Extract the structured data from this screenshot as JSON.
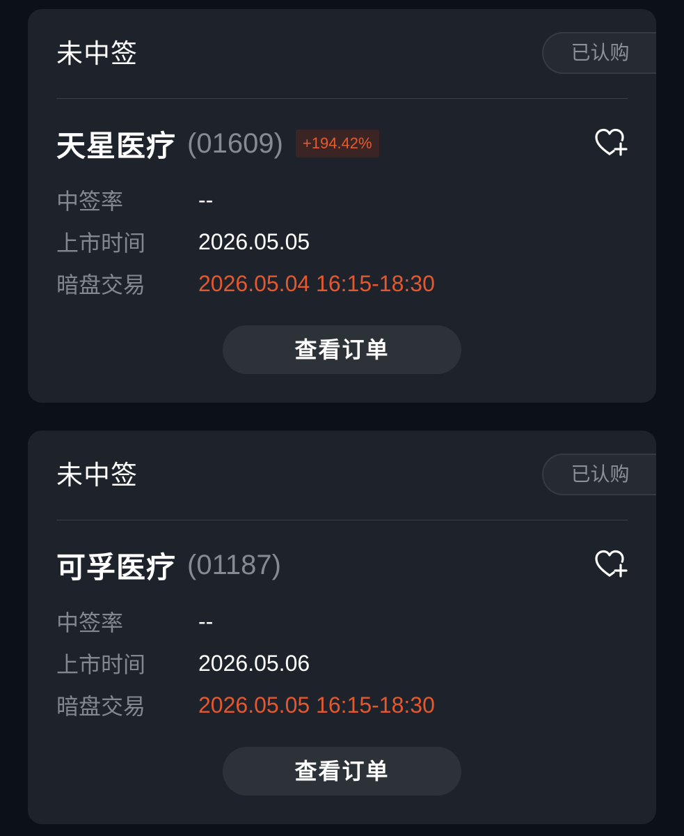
{
  "cards": [
    {
      "status": "未中签",
      "badge": "已认购",
      "name": "天星医疗",
      "code": "(01609)",
      "change": "+194.42%",
      "rows": [
        {
          "label": "中签率",
          "value": "--"
        },
        {
          "label": "上市时间",
          "value": "2026.05.05"
        },
        {
          "label": "暗盘交易",
          "value": "2026.05.04 16:15-18:30"
        }
      ],
      "button": "查看订单",
      "favorite_icon": "heart-plus-icon"
    },
    {
      "status": "未中签",
      "badge": "已认购",
      "name": "可孚医疗",
      "code": "(01187)",
      "rows": [
        {
          "label": "中签率",
          "value": "--"
        },
        {
          "label": "上市时间",
          "value": "2026.05.06"
        },
        {
          "label": "暗盘交易",
          "value": "2026.05.05 16:15-18:30"
        }
      ],
      "button": "查看订单",
      "favorite_icon": "heart-plus-icon"
    }
  ],
  "colors": {
    "background": "#0c1118",
    "card": "#1e232b",
    "accent_orange": "#e4582f",
    "muted_text": "#838790"
  }
}
